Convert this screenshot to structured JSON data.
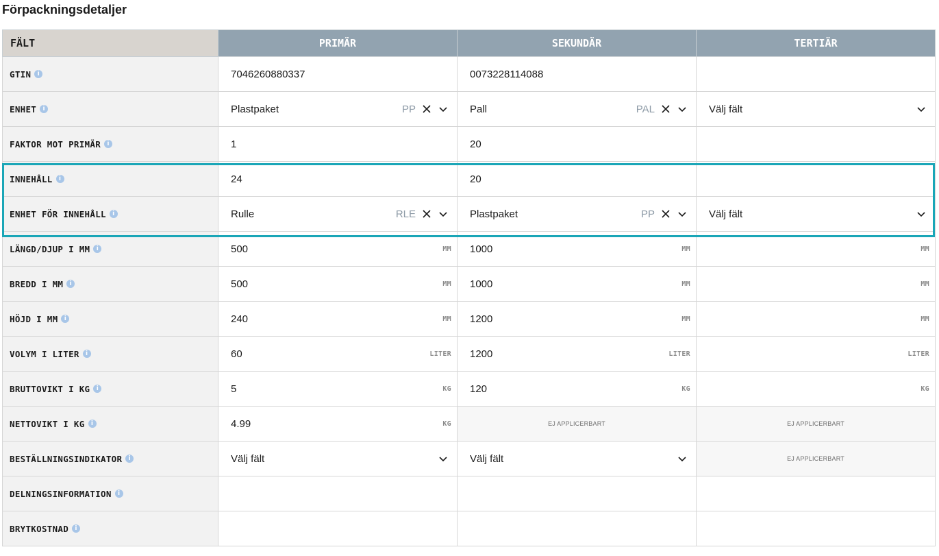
{
  "title": "Förpackningsdetaljer",
  "columns": {
    "field": "FÄLT",
    "primary": "PRIMÄR",
    "secondary": "SEKUNDÄR",
    "tertiary": "TERTIÄR"
  },
  "rows": {
    "gtin": {
      "label": "GTIN",
      "primary": "7046260880337",
      "secondary": "0073228114088",
      "tertiary": ""
    },
    "enhet": {
      "label": "ENHET",
      "primary": {
        "value": "Plastpaket",
        "code": "PP"
      },
      "secondary": {
        "value": "Pall",
        "code": "PAL"
      },
      "tertiary": {
        "placeholder": "Välj fält"
      }
    },
    "faktor": {
      "label": "FAKTOR MOT PRIMÄR",
      "primary": "1",
      "secondary": "20",
      "tertiary": ""
    },
    "innehall": {
      "label": "INNEHÅLL",
      "primary": "24",
      "secondary": "20",
      "tertiary": ""
    },
    "enhet_innehall": {
      "label": "ENHET FÖR INNEHÅLL",
      "primary": {
        "value": "Rulle",
        "code": "RLE"
      },
      "secondary": {
        "value": "Plastpaket",
        "code": "PP"
      },
      "tertiary": {
        "placeholder": "Välj fält"
      }
    },
    "langd": {
      "label": "LÄNGD/DJUP I MM",
      "primary": "500",
      "secondary": "1000",
      "tertiary": "",
      "unit": "MM"
    },
    "bredd": {
      "label": "BREDD I MM",
      "primary": "500",
      "secondary": "1000",
      "tertiary": "",
      "unit": "MM"
    },
    "hojd": {
      "label": "HÖJD I MM",
      "primary": "240",
      "secondary": "1200",
      "tertiary": "",
      "unit": "MM"
    },
    "volym": {
      "label": "VOLYM I LITER",
      "primary": "60",
      "secondary": "1200",
      "tertiary": "",
      "unit": "LITER"
    },
    "brutto": {
      "label": "BRUTTOVIKT I KG",
      "primary": "5",
      "secondary": "120",
      "tertiary": "",
      "unit": "KG"
    },
    "netto": {
      "label": "NETTOVIKT I KG",
      "primary": "4.99",
      "unit": "KG",
      "not_applicable": "EJ APPLICERBART"
    },
    "bestallning": {
      "label": "BESTÄLLNINGSINDIKATOR",
      "primary_placeholder": "Välj fält",
      "secondary_placeholder": "Välj fält",
      "not_applicable": "EJ APPLICERBART"
    },
    "delning": {
      "label": "DELNINGSINFORMATION"
    },
    "brytkostnad": {
      "label": "BRYTKOSTNAD"
    }
  },
  "icons": {
    "info": "info-icon",
    "clear": "close-icon",
    "dropdown": "chevron-down-icon"
  },
  "colors": {
    "header_bg": "#92a3b0",
    "field_header_bg": "#d8d4cf",
    "highlight": "#1aa6b7",
    "info_icon": "#a8c6e8"
  }
}
